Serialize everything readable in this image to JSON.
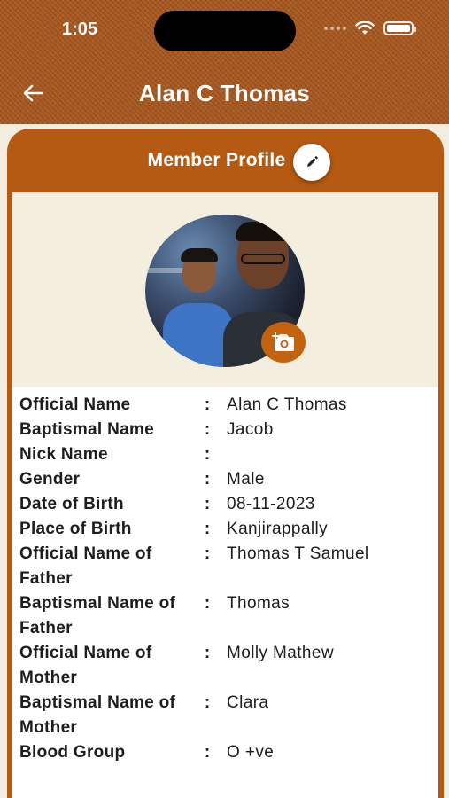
{
  "status_bar": {
    "time": "1:05"
  },
  "header": {
    "title": "Alan C Thomas"
  },
  "card": {
    "title": "Member Profile"
  },
  "icons": {
    "back": "arrow-left-icon",
    "edit": "pencil-icon",
    "camera": "camera-plus-icon",
    "wifi": "wifi-icon",
    "battery": "battery-icon"
  },
  "colors": {
    "accent": "#b55a12",
    "header_bg": "#a8561c",
    "camera_btn": "#c4630f"
  },
  "details": [
    {
      "label": "Official Name",
      "value": "Alan C Thomas"
    },
    {
      "label": "Baptismal Name",
      "value": "Jacob"
    },
    {
      "label": "Nick Name",
      "value": ""
    },
    {
      "label": "Gender",
      "value": "Male"
    },
    {
      "label": "Date of Birth",
      "value": "08-11-2023"
    },
    {
      "label": "Place of Birth",
      "value": "Kanjirappally"
    },
    {
      "label": "Official Name of Father",
      "value": "Thomas T Samuel"
    },
    {
      "label": "Baptismal Name of Father",
      "value": "Thomas"
    },
    {
      "label": "Official Name of Mother",
      "value": "Molly Mathew"
    },
    {
      "label": "Baptismal Name of Mother",
      "value": "Clara"
    },
    {
      "label": "Blood Group",
      "value": "O +ve"
    }
  ],
  "separator": ":"
}
